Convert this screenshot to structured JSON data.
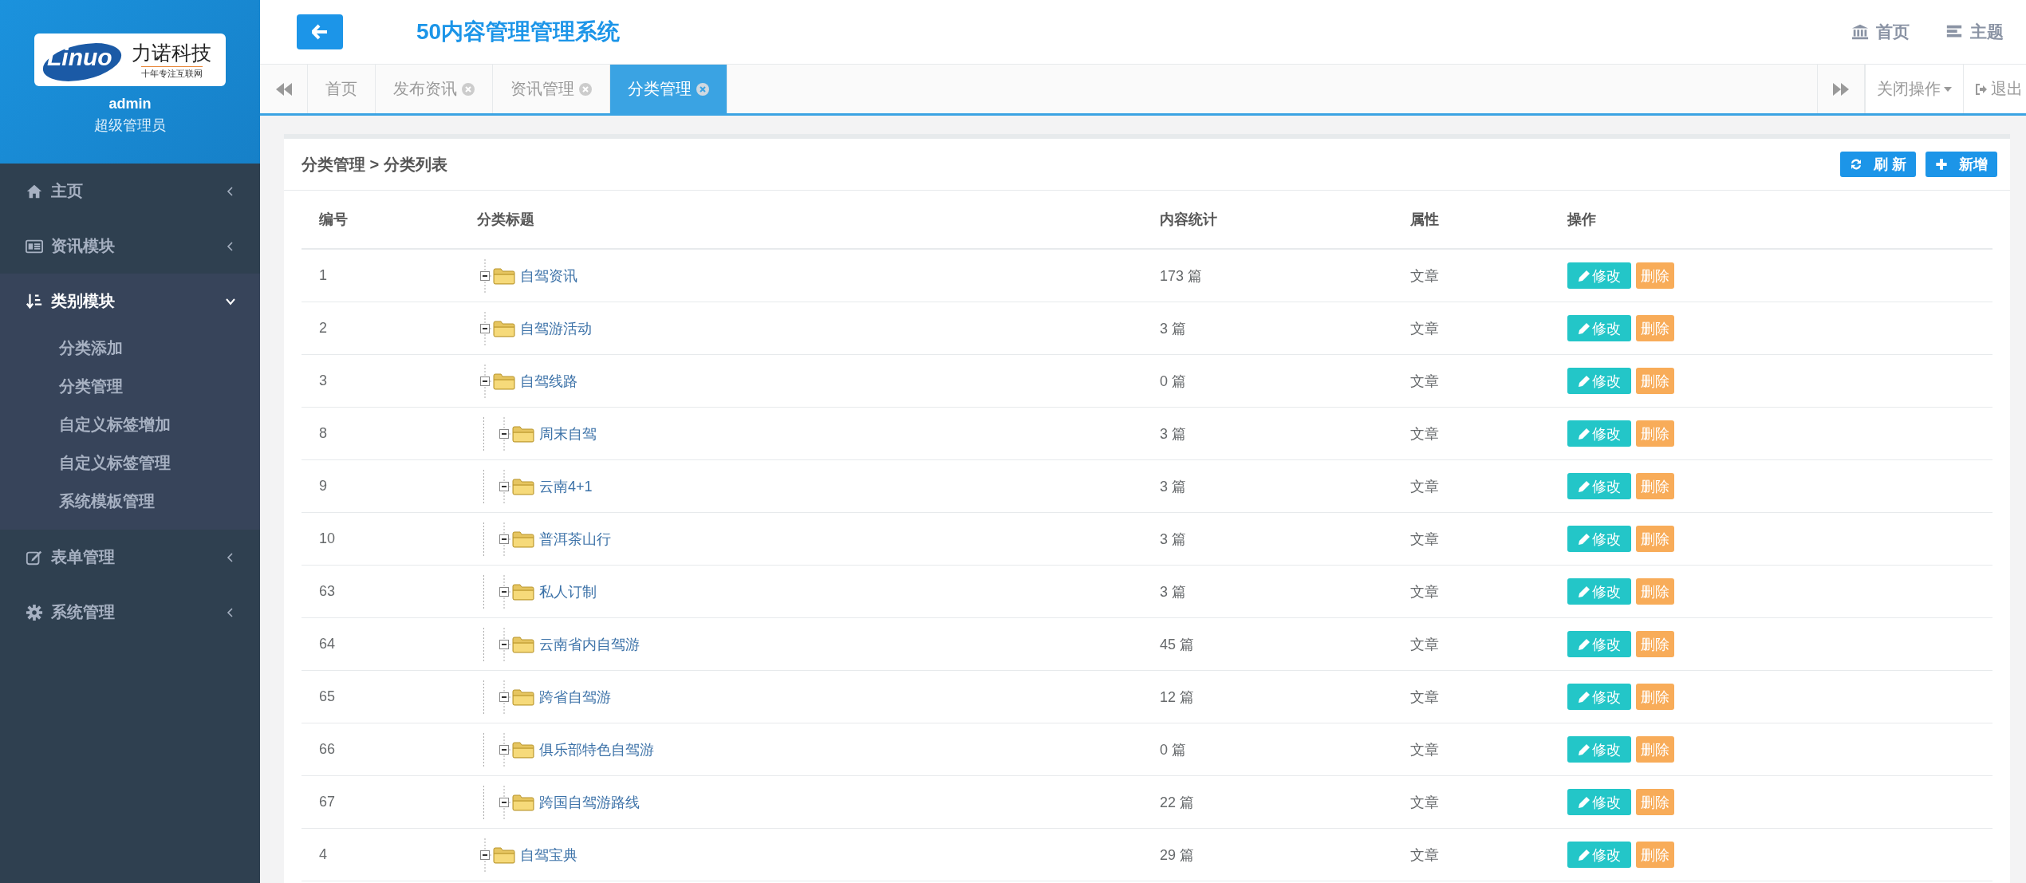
{
  "sidebar": {
    "logo": {
      "brand": "Linuo",
      "name": "力诺科技",
      "slogan": "十年专注互联网"
    },
    "user": {
      "name": "admin",
      "role": "超级管理员"
    },
    "items": [
      {
        "label": "主页",
        "expanded": false
      },
      {
        "label": "资讯模块",
        "expanded": false
      },
      {
        "label": "类别模块",
        "expanded": true,
        "children": [
          {
            "label": "分类添加"
          },
          {
            "label": "分类管理"
          },
          {
            "label": "自定义标签增加"
          },
          {
            "label": "自定义标签管理"
          },
          {
            "label": "系统模板管理"
          }
        ]
      },
      {
        "label": "表单管理",
        "expanded": false
      },
      {
        "label": "系统管理",
        "expanded": false
      }
    ]
  },
  "header": {
    "title": "50内容管理管理系统",
    "links": [
      {
        "label": "首页"
      },
      {
        "label": "主题"
      }
    ]
  },
  "tabs": [
    {
      "label": "首页",
      "closable": false,
      "selected": false
    },
    {
      "label": "发布资讯",
      "closable": true,
      "selected": false
    },
    {
      "label": "资讯管理",
      "closable": true,
      "selected": false
    },
    {
      "label": "分类管理",
      "closable": true,
      "selected": true
    }
  ],
  "tab_tools": {
    "close_menu": "关闭操作",
    "logout": "退出"
  },
  "panel": {
    "breadcrumb": "分类管理 > 分类列表",
    "buttons": [
      {
        "label": "刷 新"
      },
      {
        "label": "新增"
      }
    ]
  },
  "table": {
    "columns": [
      "编号",
      "分类标题",
      "内容统计",
      "属性",
      "操作"
    ],
    "rows": [
      {
        "id": "1",
        "title": "自驾资讯",
        "count": "173 篇",
        "type": "文章",
        "edit": "修改",
        "delete": "删除"
      },
      {
        "id": "2",
        "title": "自驾游活动",
        "count": "3 篇",
        "type": "文章",
        "edit": "修改",
        "delete": "删除"
      },
      {
        "id": "3",
        "title": "自驾线路",
        "count": "0 篇",
        "type": "文章",
        "edit": "修改",
        "delete": "删除",
        "children": [
          {
            "id": "8",
            "title": "周末自驾",
            "count": "3 篇",
            "type": "文章",
            "edit": "修改",
            "delete": "删除"
          },
          {
            "id": "9",
            "title": "云南4+1",
            "count": "3 篇",
            "type": "文章",
            "edit": "修改",
            "delete": "删除"
          },
          {
            "id": "10",
            "title": "普洱茶山行",
            "count": "3 篇",
            "type": "文章",
            "edit": "修改",
            "delete": "删除"
          },
          {
            "id": "63",
            "title": "私人订制",
            "count": "3 篇",
            "type": "文章",
            "edit": "修改",
            "delete": "删除"
          },
          {
            "id": "64",
            "title": "云南省内自驾游",
            "count": "45 篇",
            "type": "文章",
            "edit": "修改",
            "delete": "删除"
          },
          {
            "id": "65",
            "title": "跨省自驾游",
            "count": "12 篇",
            "type": "文章",
            "edit": "修改",
            "delete": "删除"
          },
          {
            "id": "66",
            "title": "俱乐部特色自驾游",
            "count": "0 篇",
            "type": "文章",
            "edit": "修改",
            "delete": "删除"
          },
          {
            "id": "67",
            "title": "跨国自驾游路线",
            "count": "22 篇",
            "type": "文章",
            "edit": "修改",
            "delete": "删除"
          }
        ]
      },
      {
        "id": "4",
        "title": "自驾宝典",
        "count": "29 篇",
        "type": "文章",
        "edit": "修改",
        "delete": "删除"
      }
    ]
  }
}
